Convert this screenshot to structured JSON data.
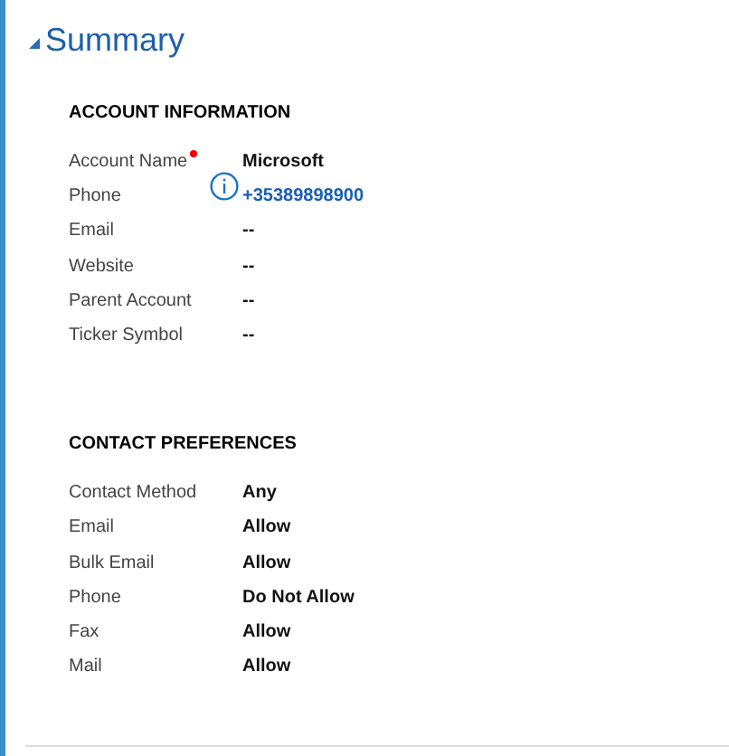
{
  "section": {
    "title": "Summary",
    "expanded": true
  },
  "groups": [
    {
      "heading": "ACCOUNT INFORMATION",
      "rows": [
        {
          "label": "Account Name",
          "required": true,
          "kind": "text",
          "value": "Microsoft"
        },
        {
          "label": "Phone",
          "required": false,
          "kind": "link",
          "value": "+35389898900"
        },
        {
          "label": "Email",
          "required": false,
          "kind": "text",
          "value": "--"
        },
        {
          "label": "Website",
          "required": false,
          "kind": "text",
          "value": "--"
        },
        {
          "label": "Parent Account",
          "required": false,
          "kind": "text",
          "value": "--"
        },
        {
          "label": "Ticker Symbol",
          "required": false,
          "kind": "text",
          "value": "--"
        }
      ]
    },
    {
      "heading": "CONTACT PREFERENCES",
      "rows": [
        {
          "label": "Contact Method",
          "required": false,
          "kind": "text",
          "value": "Any"
        },
        {
          "label": "Email",
          "required": false,
          "kind": "text",
          "value": "Allow"
        },
        {
          "label": "Bulk Email",
          "required": false,
          "kind": "text",
          "value": "Allow"
        },
        {
          "label": "Phone",
          "required": false,
          "kind": "text",
          "value": "Do Not Allow"
        },
        {
          "label": "Fax",
          "required": false,
          "kind": "text",
          "value": "Allow"
        },
        {
          "label": "Mail",
          "required": false,
          "kind": "text",
          "value": "Allow"
        }
      ]
    }
  ]
}
